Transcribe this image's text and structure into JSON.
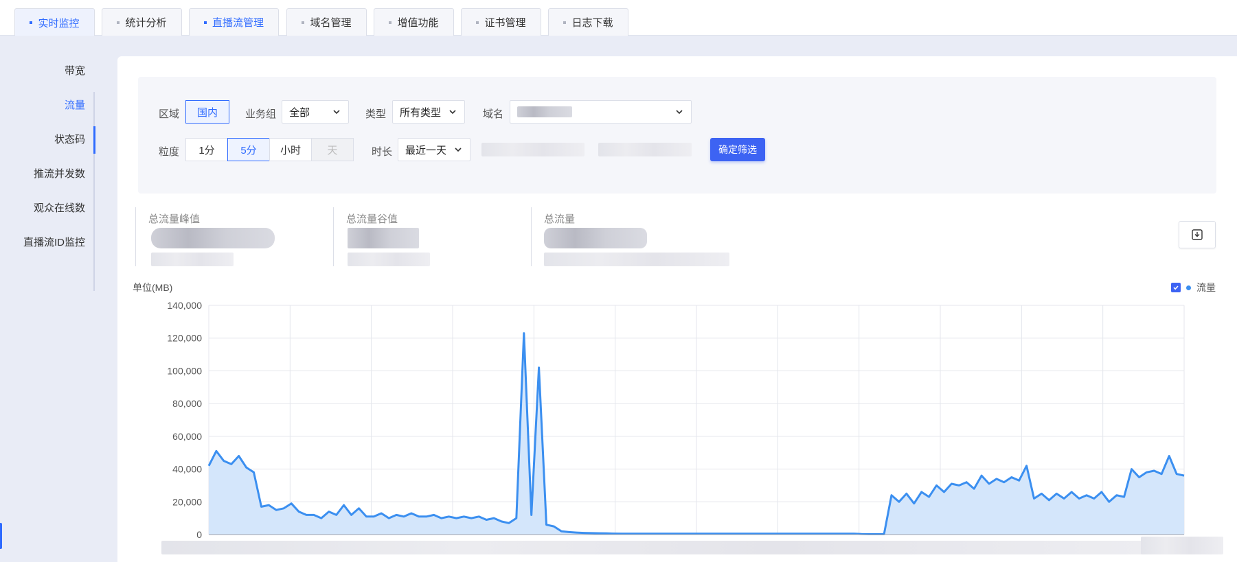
{
  "tabs": [
    {
      "label": "实时监控",
      "style": "active"
    },
    {
      "label": "统计分析",
      "style": ""
    },
    {
      "label": "直播流管理",
      "style": "blue"
    },
    {
      "label": "域名管理",
      "style": ""
    },
    {
      "label": "增值功能",
      "style": ""
    },
    {
      "label": "证书管理",
      "style": ""
    },
    {
      "label": "日志下载",
      "style": ""
    }
  ],
  "sidebar": {
    "items": [
      "带宽",
      "流量",
      "状态码",
      "推流并发数",
      "观众在线数",
      "直播流ID监控"
    ],
    "active_index": 1
  },
  "filters": {
    "region_label": "区域",
    "region_value": "国内",
    "group_label": "业务组",
    "group_value": "全部",
    "type_label": "类型",
    "type_value": "所有类型",
    "domain_label": "域名",
    "granularity_label": "粒度",
    "granularity_options": [
      "1分",
      "5分",
      "小时",
      "天"
    ],
    "granularity_selected": 1,
    "granularity_disabled": 3,
    "duration_label": "时长",
    "duration_value": "最近一天",
    "confirm_label": "确定筛选"
  },
  "stats": {
    "peak_label": "总流量峰值",
    "valley_label": "总流量谷值",
    "total_label": "总流量"
  },
  "chart": {
    "unit_label": "单位(MB)",
    "legend_label": "流量",
    "accent": "#3b8ff0",
    "fill": "#d4e6fb"
  },
  "chart_data": {
    "type": "area",
    "ylabel": "单位(MB)",
    "ylim": [
      0,
      140000
    ],
    "y_ticks": [
      "140,000",
      "120,000",
      "100,000",
      "80,000",
      "60,000",
      "40,000",
      "20,000",
      "0"
    ],
    "grid": true,
    "legend": "top-right",
    "series": [
      {
        "name": "流量",
        "values": [
          42000,
          51000,
          45000,
          43000,
          48000,
          41000,
          38000,
          17000,
          18000,
          15000,
          16000,
          19000,
          14000,
          12000,
          12000,
          10000,
          14000,
          12000,
          18000,
          12000,
          16000,
          11000,
          11000,
          13000,
          10000,
          12000,
          11000,
          13000,
          11000,
          11000,
          12000,
          10000,
          11000,
          10000,
          11000,
          10000,
          11000,
          9000,
          10000,
          8000,
          7000,
          10000,
          123000,
          12000,
          102000,
          6000,
          5000,
          2000,
          1500,
          1200,
          1000,
          900,
          800,
          700,
          600,
          500,
          500,
          500,
          500,
          500,
          500,
          500,
          500,
          500,
          500,
          500,
          500,
          500,
          500,
          500,
          500,
          500,
          500,
          500,
          500,
          500,
          500,
          500,
          500,
          500,
          500,
          500,
          500,
          500,
          500,
          500,
          500,
          300,
          200,
          200,
          200,
          24000,
          20000,
          25000,
          19000,
          26000,
          23000,
          30000,
          26000,
          31000,
          30000,
          32000,
          28000,
          36000,
          31000,
          34000,
          32000,
          35000,
          33000,
          42000,
          22000,
          25000,
          21000,
          25000,
          22000,
          26000,
          22000,
          24000,
          22000,
          26000,
          20000,
          24000,
          23000,
          40000,
          35000,
          38000,
          39000,
          37000,
          48000,
          37000,
          36000
        ]
      }
    ]
  }
}
